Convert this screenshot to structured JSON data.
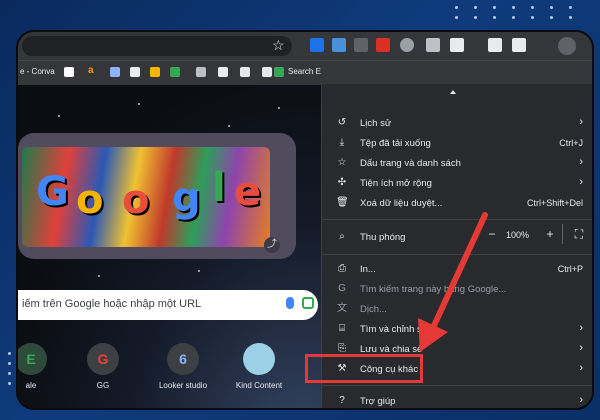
{
  "bookmarks": {
    "items": [
      "e - Conva",
      "a",
      "Search E"
    ]
  },
  "ntp": {
    "search_placeholder": "iếm trên Google hoặc nhập một URL",
    "doodle_letters": [
      "G",
      "o",
      "o",
      "g",
      "l",
      "e"
    ],
    "shortcuts": [
      {
        "letter": "E",
        "label": "ale"
      },
      {
        "letter": "G",
        "label": "GG"
      },
      {
        "letter": "6",
        "label": "Looker studio"
      },
      {
        "letter": "",
        "label": "Kind Content"
      }
    ]
  },
  "menu": {
    "history": "Lịch sử",
    "downloads": "Tệp đã tải xuống",
    "downloads_shortcut": "Ctrl+J",
    "bookmarks": "Dấu trang và danh sách",
    "extensions": "Tiện ích mở rộng",
    "clear_data": "Xoá dữ liệu duyệt...",
    "clear_data_shortcut": "Ctrl+Shift+Del",
    "zoom": "Thu phóng",
    "zoom_minus": "−",
    "zoom_value": "100%",
    "zoom_plus": "+",
    "print": "In...",
    "print_shortcut": "Ctrl+P",
    "search_page": "Tìm kiếm trang này bằng Google...",
    "translate": "Dịch...",
    "find_edit": "Tìm và chỉnh sửa",
    "save_share": "Lưu và chia sẻ",
    "more_tools": "Công cụ khác",
    "help": "Trợ giúp"
  },
  "colors": {
    "highlight": "#e53935",
    "menu_bg": "#292a2d"
  }
}
